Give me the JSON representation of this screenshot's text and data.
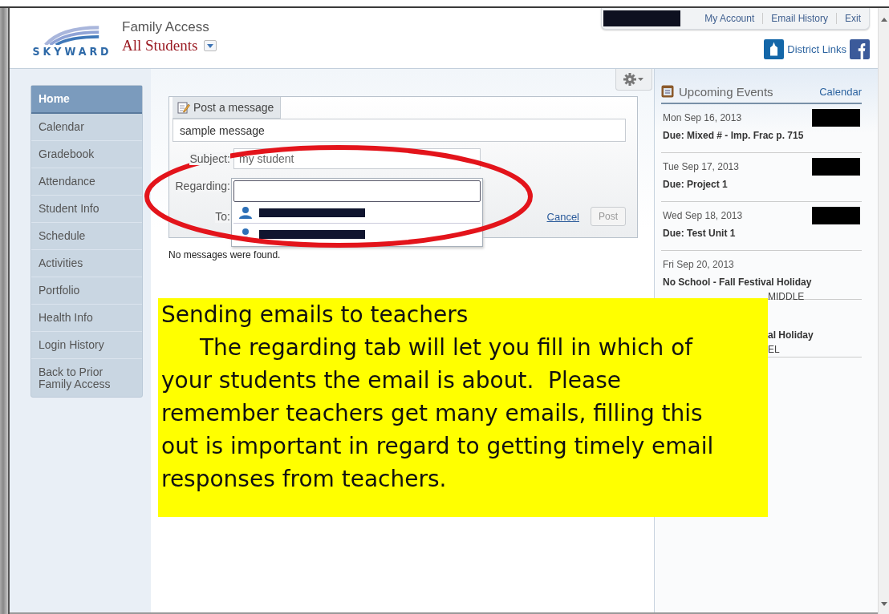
{
  "header": {
    "logo": "SKYWARD",
    "app_title": "Family Access",
    "student_selector": "All Students",
    "account_links": [
      "My Account",
      "Email History",
      "Exit"
    ],
    "district_links": "District Links"
  },
  "nav": [
    {
      "label": "Home",
      "selected": true
    },
    {
      "label": "Calendar",
      "selected": false
    },
    {
      "label": "Gradebook",
      "selected": false
    },
    {
      "label": "Attendance",
      "selected": false
    },
    {
      "label": "Student Info",
      "selected": false
    },
    {
      "label": "Schedule",
      "selected": false
    },
    {
      "label": "Activities",
      "selected": false
    },
    {
      "label": "Portfolio",
      "selected": false
    },
    {
      "label": "Health Info",
      "selected": false
    },
    {
      "label": "Login History",
      "selected": false
    },
    {
      "label": "Back to Prior Family Access",
      "selected": false
    }
  ],
  "message_form": {
    "tab": "Post a message",
    "message": "sample message",
    "subject_label": "Subject:",
    "subject": "my student",
    "regarding_label": "Regarding:",
    "to_label": "To:",
    "cancel": "Cancel",
    "post": "Post"
  },
  "empty_message": "No messages were found.",
  "events": {
    "title": "Upcoming Events",
    "calendar_link": "Calendar",
    "items": [
      {
        "date": "Mon Sep 16, 2013",
        "title": "Due: Mixed # - Imp. Frac p. 715",
        "redacted": true
      },
      {
        "date": "Tue Sep 17, 2013",
        "title": "Due: Project 1",
        "redacted": true
      },
      {
        "date": "Wed Sep 18, 2013",
        "title": "Due: Test Unit 1",
        "redacted": true
      },
      {
        "date": "Fri Sep 20, 2013",
        "title": "No School - Fall Festival Holiday",
        "subtitle": "MIDDLE",
        "redacted": false
      },
      {
        "title": "al Holiday",
        "subtitle": "EL",
        "redacted": false
      }
    ]
  },
  "callout": {
    "title": "Sending emails to teachers",
    "body": "The regarding tab will let you fill in which of\nyour students the email is about.  Please\nremember teachers get many emails, filling this\nout is important in regard to getting timely email\nresponses from teachers."
  }
}
